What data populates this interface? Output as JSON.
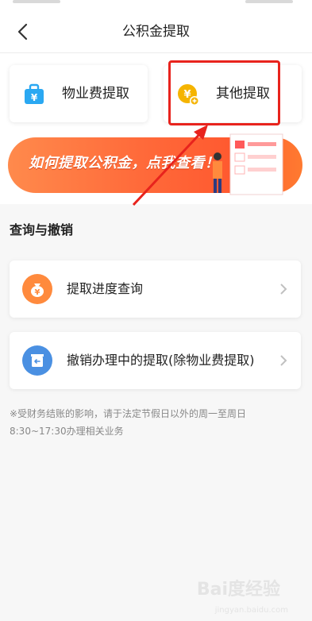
{
  "header": {
    "title": "公积金提取",
    "back_icon": "chevron-left-icon"
  },
  "withdraw_types": [
    {
      "label": "物业费提取",
      "icon": "briefcase-icon",
      "color": "#2aa8f2"
    },
    {
      "label": "其他提取",
      "icon": "yuan-coin-icon",
      "color": "#f5b400"
    }
  ],
  "banner": {
    "text": "如何提取公积金，点我查看！",
    "colors": {
      "start": "#ff8a4c",
      "end": "#ff5a30"
    }
  },
  "section": {
    "title": "查询与撤销"
  },
  "rows": [
    {
      "label": "提取进度查询",
      "icon": "money-bag-icon",
      "color": "#ff8a3d"
    },
    {
      "label": "撤销办理中的提取(除物业费提取)",
      "icon": "undo-bin-icon",
      "color": "#4a90e2"
    }
  ],
  "note": {
    "text": "※受财务结账的影响，请于法定节假日以外的周一至周日8:30~17:30办理相关业务"
  },
  "watermark": {
    "text": "Bai度经验",
    "sub": "jingyan.baidu.com"
  },
  "annotation": {
    "highlight_color": "#e8231d"
  }
}
